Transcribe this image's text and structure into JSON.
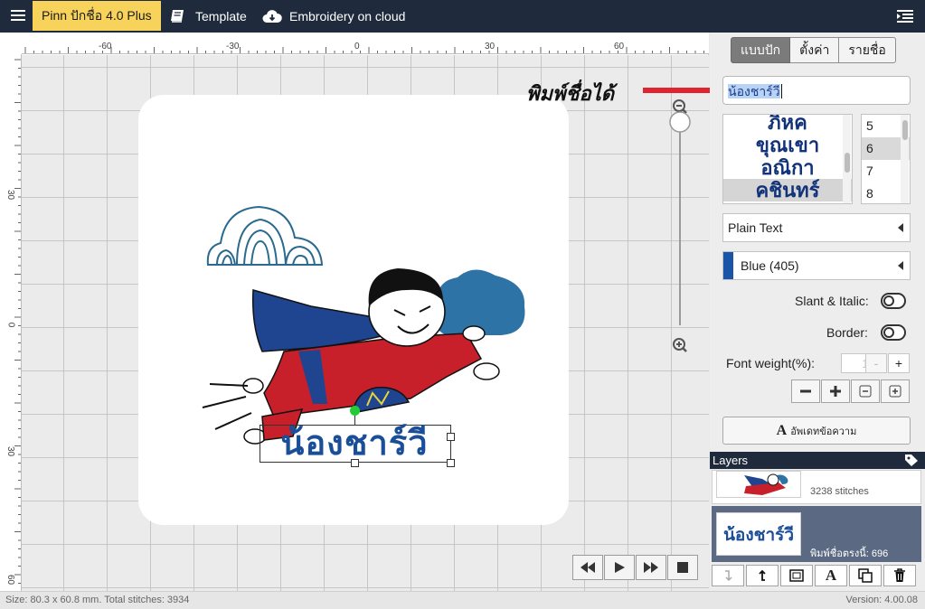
{
  "topbar": {
    "brand": "Pinn ปักชื่อ 4.0 Plus",
    "template_label": "Template",
    "cloud_label": "Embroidery on cloud"
  },
  "ruler": {
    "h_labels": [
      "-60",
      "-30",
      "0",
      "30",
      "60"
    ],
    "v_labels": [
      "30",
      "0",
      "30",
      "60"
    ]
  },
  "canvas": {
    "callout_text": "พิมพ์ชื่อได้",
    "embroidered_name": "น้องชาร์วี",
    "colors": {
      "name": "#1b4e98",
      "cape": "#1f4590",
      "suit": "#c8202a",
      "cloud_outline": "#2a6a90",
      "cloud_fill": "#2e73a6",
      "handle": "#22cc33"
    }
  },
  "playback": {
    "buttons": [
      "rewind-icon",
      "play-icon",
      "fast-forward-icon",
      "stop-icon"
    ]
  },
  "status": {
    "left": "Size: 80.3 x 60.8 mm.  Total stitches: 3934",
    "right": "Version: 4.00.08"
  },
  "panel": {
    "tabs": [
      "แบบปัก",
      "ตั้งค่า",
      "รายชื่อ"
    ],
    "active_tab": 0,
    "name_value": "น้องชาร์วี",
    "fonts": [
      "ภิหค",
      "ขุณเขา",
      "อณิกา",
      "คชินทร์"
    ],
    "selected_font": 3,
    "sizes": [
      "5",
      "6",
      "7",
      "8"
    ],
    "selected_size": 1,
    "text_style": "Plain Text",
    "thread_color": "Blue (405)",
    "thread_hex": "#1a55a8",
    "slant_label": "Slant & Italic:",
    "slant_on": false,
    "border_label": "Border:",
    "border_on": false,
    "weight_label": "Font weight(%):",
    "weight_value": "100",
    "minus": "-",
    "plus": "+",
    "update_icon": "A",
    "update_label": "อัพเดทข้อความ"
  },
  "layers": {
    "title": "Layers",
    "items": [
      {
        "label": "3238 stitches",
        "selected": false
      },
      {
        "label": "พิมพ์ชื่อตรงนี้: 696",
        "name_preview": "น้องชาร์วี",
        "selected": true
      }
    ],
    "tools": [
      "move-down-icon",
      "move-up-icon",
      "resize-icon",
      "text-icon",
      "duplicate-icon",
      "trash-icon"
    ]
  }
}
